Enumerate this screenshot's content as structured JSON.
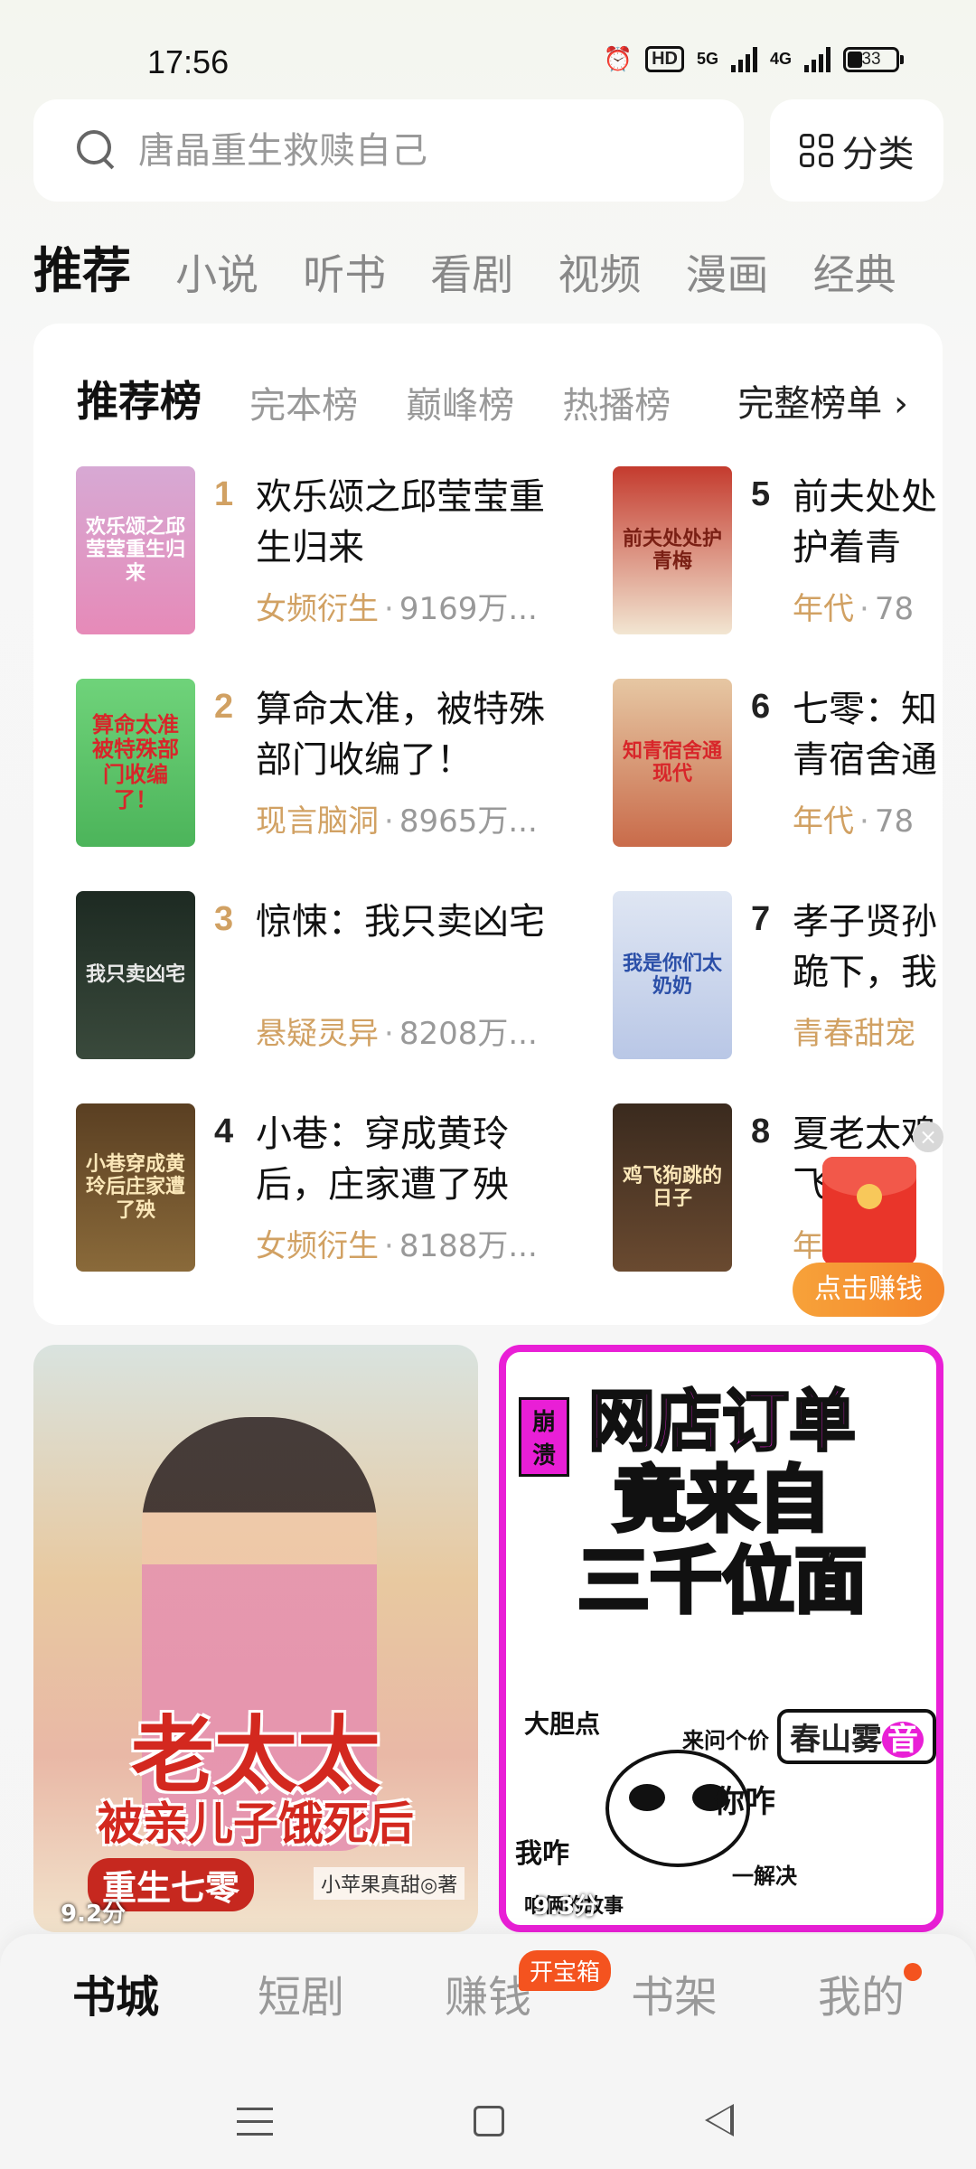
{
  "status_bar": {
    "time": "17:56",
    "hd_label": "HD",
    "net1": "5G",
    "net2": "4G",
    "battery": "33"
  },
  "search": {
    "placeholder": "唐晶重生救赎自己",
    "category_label": "分类"
  },
  "top_tabs": [
    "推荐",
    "小说",
    "听书",
    "看剧",
    "视频",
    "漫画",
    "经典"
  ],
  "rank": {
    "tabs": [
      "推荐榜",
      "完本榜",
      "巅峰榜",
      "热播榜"
    ],
    "more_label": "完整榜单",
    "books": [
      {
        "no": "1",
        "title": "欢乐颂之邱莹莹重生归来",
        "genre": "女频衍生",
        "count": "9169万...",
        "cover_text": "欢乐颂之邱莹莹重生归来"
      },
      {
        "no": "2",
        "title": "算命太准，被特殊部门收编了！",
        "genre": "现言脑洞",
        "count": "8965万...",
        "cover_text": "算命太准被特殊部门收编了！"
      },
      {
        "no": "3",
        "title": "惊悚：我只卖凶宅",
        "genre": "悬疑灵异",
        "count": "8208万...",
        "cover_text": "我只卖凶宅"
      },
      {
        "no": "4",
        "title": "小巷：穿成黄玲后，庄家遭了殃",
        "genre": "女频衍生",
        "count": "8188万...",
        "cover_text": "小巷穿成黄玲后庄家遭了殃"
      },
      {
        "no": "5",
        "title": "前夫处处护着青梅，重生",
        "genre": "年代",
        "count": "78",
        "cover_text": "前夫处处护青梅"
      },
      {
        "no": "6",
        "title": "七零：知青宿舍通现代",
        "genre": "年代",
        "count": "78",
        "cover_text": "知青宿舍通现代"
      },
      {
        "no": "7",
        "title": "孝子贤孙跪下，我是",
        "genre": "青春甜宠",
        "count": "",
        "cover_text": "我是你们太奶奶"
      },
      {
        "no": "8",
        "title": "夏老太鸡飞",
        "genre": "年",
        "count": "",
        "cover_text": "鸡飞狗跳的日子"
      }
    ]
  },
  "promo": {
    "close": "×",
    "earn_label": "点击赚钱"
  },
  "posters": [
    {
      "title1": "老太太",
      "title2": "被亲儿子饿死后",
      "title3": "重生七零",
      "author": "小苹果真甜◎著",
      "score": "9.2分"
    },
    {
      "tag": "崩溃",
      "line1": "网店订单",
      "line2": "竟来自",
      "line3": "三千位面",
      "sign": "春山雾",
      "sign_badge": "音",
      "caption1": "大胆点",
      "caption2": "来问个价",
      "caption3": "你咋",
      "caption4": "我咋",
      "caption5": "一解决",
      "caption6": "咱俩的故事",
      "score": "9.3分"
    }
  ],
  "bottom_nav": {
    "items": [
      "书城",
      "短剧",
      "赚钱",
      "书架",
      "我的"
    ],
    "badge": "开宝箱"
  }
}
